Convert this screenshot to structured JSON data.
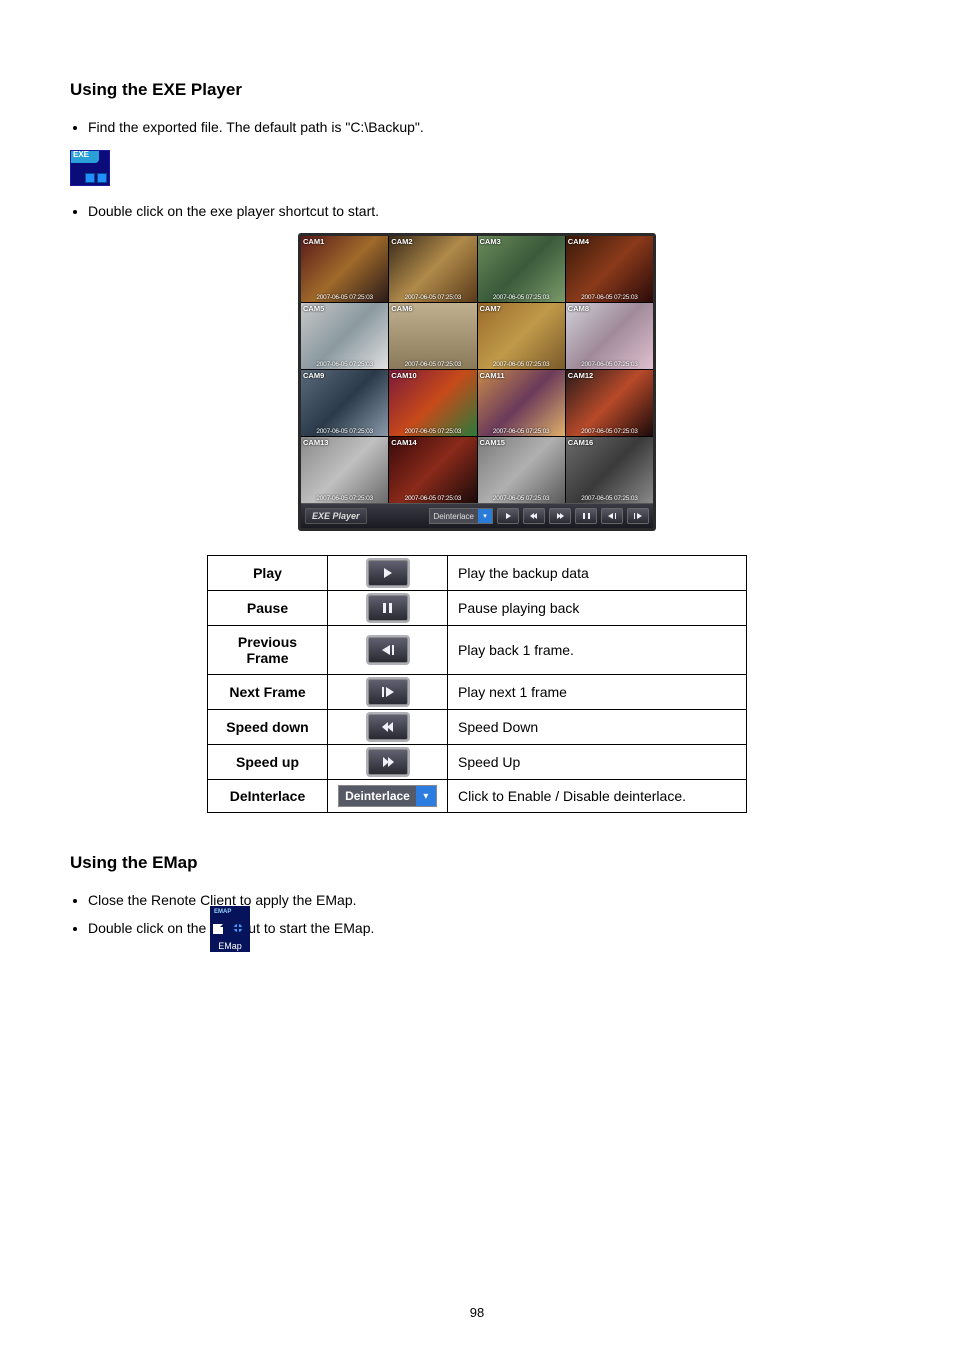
{
  "sections": {
    "exe_title": "Using the EXE Player",
    "emap_title": "Using the EMap"
  },
  "exe_bullets": [
    "Find the exported file. The default path is \"C:\\Backup\".",
    "Double click on the exe player shortcut to start."
  ],
  "exe_icon_label": "EXE",
  "emap_bullets": [
    "Close the Renote Client to apply the EMap.",
    "Double click on the              shortcut to start the EMap."
  ],
  "emap_icon": {
    "top": "EMAP",
    "caption": "EMap"
  },
  "player": {
    "brand": "EXE Player",
    "deinterlace": "Deinterlace",
    "timestamp": "2007-06-05 07:25:03",
    "cams": [
      "CAM1",
      "CAM2",
      "CAM3",
      "CAM4",
      "CAM5",
      "CAM6",
      "CAM7",
      "CAM8",
      "CAM9",
      "CAM10",
      "CAM11",
      "CAM12",
      "CAM13",
      "CAM14",
      "CAM15",
      "CAM16"
    ]
  },
  "controls": [
    {
      "name": "Play",
      "icon": "play",
      "desc": "Play the backup data"
    },
    {
      "name": "Pause",
      "icon": "pause",
      "desc": "Pause playing back"
    },
    {
      "name": "Previous Frame",
      "icon": "prevf",
      "desc": "Play back 1 frame."
    },
    {
      "name": "Next Frame",
      "icon": "nextf",
      "desc": "Play next 1 frame"
    },
    {
      "name": "Speed down",
      "icon": "rew",
      "desc": "Speed Down"
    },
    {
      "name": "Speed up",
      "icon": "ff",
      "desc": "Speed Up"
    },
    {
      "name": "DeInterlace",
      "icon": "deint",
      "desc": "Click to Enable / Disable deinterlace."
    }
  ],
  "page_number": "98"
}
